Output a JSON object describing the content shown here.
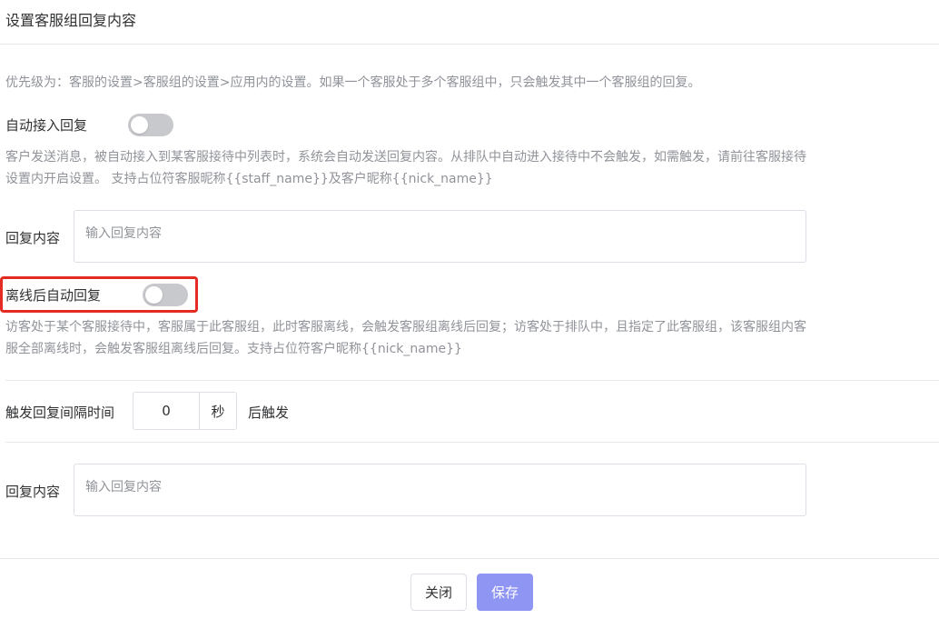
{
  "dialog": {
    "title": "设置客服组回复内容",
    "priority_note": "优先级为：客服的设置>客服组的设置>应用内的设置。如果一个客服处于多个客服组中，只会触发其中一个客服组的回复。"
  },
  "auto_join": {
    "label": "自动接入回复",
    "enabled": false,
    "description_line1": "客户发送消息，被自动接入到某客服接待中列表时，系统会自动发送回复内容。从排队中自动进入接待中不会触发，如需触发，请前往客服接待",
    "description_line2": "设置内开启设置。 支持占位符客服昵称{{staff_name}}及客户昵称{{nick_name}}",
    "reply_label": "回复内容",
    "reply_placeholder": "输入回复内容"
  },
  "offline_reply": {
    "label": "离线后自动回复",
    "enabled": false,
    "description_line1": "访客处于某个客服接待中，客服属于此客服组，此时客服离线，会触发客服组离线后回复；访客处于排队中，且指定了此客服组，该客服组内客",
    "description_line2": "服全部离线时，会触发客服组离线后回复。支持占位符客户昵称{{nick_name}}"
  },
  "interval": {
    "label": "触发回复间隔时间",
    "value": "0",
    "unit": "秒",
    "suffix": "后触发",
    "reply_label": "回复内容",
    "reply_placeholder": "输入回复内容"
  },
  "footer": {
    "close_label": "关闭",
    "save_label": "保存"
  },
  "colors": {
    "accent": "#8f95f2",
    "highlight": "#e32b24",
    "switch_off": "#c8c9cc"
  }
}
